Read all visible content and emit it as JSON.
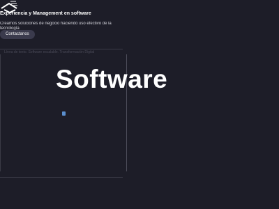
{
  "header": {
    "logo_icon": "software-logo-icon"
  },
  "hero": {
    "headline": "Experiencia y Management en software",
    "subtitle": "Creamos soluciones de negocio haciendo uso efectivo de la tecnología",
    "cta_label": "Contactanos"
  },
  "section": {
    "faint_text": "Línea de texto. Software escalable. Transformación Digital",
    "word": "Software"
  },
  "colors": {
    "background": "#1d1d28",
    "button": "#3a3a4c",
    "accent": "#5b8fcf"
  }
}
